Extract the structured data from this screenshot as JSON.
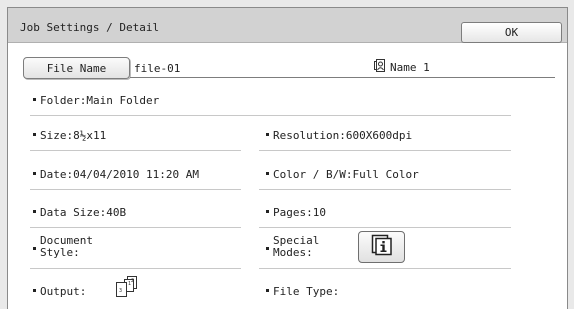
{
  "header": {
    "title": "Job Settings / Detail",
    "ok_label": "OK"
  },
  "file": {
    "button_label": "File Name",
    "value": "file-01",
    "user_name": "Name 1"
  },
  "details": {
    "folder": "Folder:Main Folder",
    "size": "Size:8½x11",
    "resolution": "Resolution:600X600dpi",
    "date": "Date:04/04/2010 11:20 AM",
    "color": "Color / B/W:Full Color",
    "data_size": "Data Size:40B",
    "pages": "Pages:10",
    "document_style_line1": "Document",
    "document_style_line2": "Style:",
    "special_modes_line1": "Special",
    "special_modes_line2": "Modes:",
    "output": "Output:",
    "file_type": "File Type:"
  },
  "icons": {
    "user": "user-icon",
    "info": "info-icon",
    "output": "sort-output-icon"
  }
}
